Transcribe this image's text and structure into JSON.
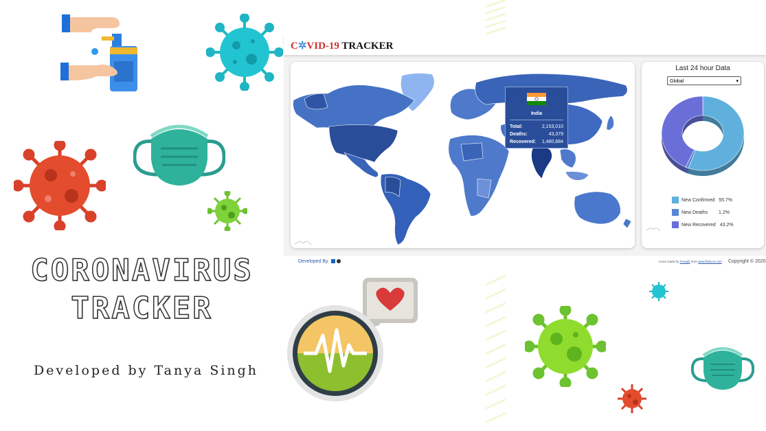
{
  "promo": {
    "title_line1": "CORONAVIRUS",
    "title_line2": "TRACKER",
    "developer_credit": "Developed by Tanya Singh"
  },
  "app": {
    "brand": {
      "c": "C",
      "vid": "VID-19",
      "tracker": "TRACKER"
    },
    "map": {
      "tooltip": {
        "country": "India",
        "total_label": "Total:",
        "total_value": "2,153,010",
        "deaths_label": "Deaths:",
        "deaths_value": "43,379",
        "recovered_label": "Recovered:",
        "recovered_value": "1,480,884"
      }
    },
    "stats": {
      "title": "Last 24 hour Data",
      "region_selected": "Global",
      "legend": [
        {
          "label": "New Confirmed",
          "value": "55.7%",
          "color": "#5fb0dd"
        },
        {
          "label": "New Deaths",
          "value": "1.2%",
          "color": "#5b86d6"
        },
        {
          "label": "New Recovered",
          "value": "43.2%",
          "color": "#6a6fd8"
        }
      ]
    },
    "footer": {
      "developed_by": "Developed By",
      "icons_credit_prefix": "Icons made by",
      "icons_credit_author": "Freepik",
      "icons_credit_mid": "from",
      "icons_credit_site": "www.flaticon.com",
      "copyright": "Copyright © 2020"
    }
  },
  "chart_data": {
    "type": "pie",
    "title": "Last 24 hour Data",
    "categories": [
      "New Confirmed",
      "New Deaths",
      "New Recovered"
    ],
    "values": [
      55.7,
      1.2,
      43.2
    ],
    "legend_position": "bottom",
    "colors": [
      "#5fb0dd",
      "#5b86d6",
      "#6a6fd8"
    ]
  }
}
